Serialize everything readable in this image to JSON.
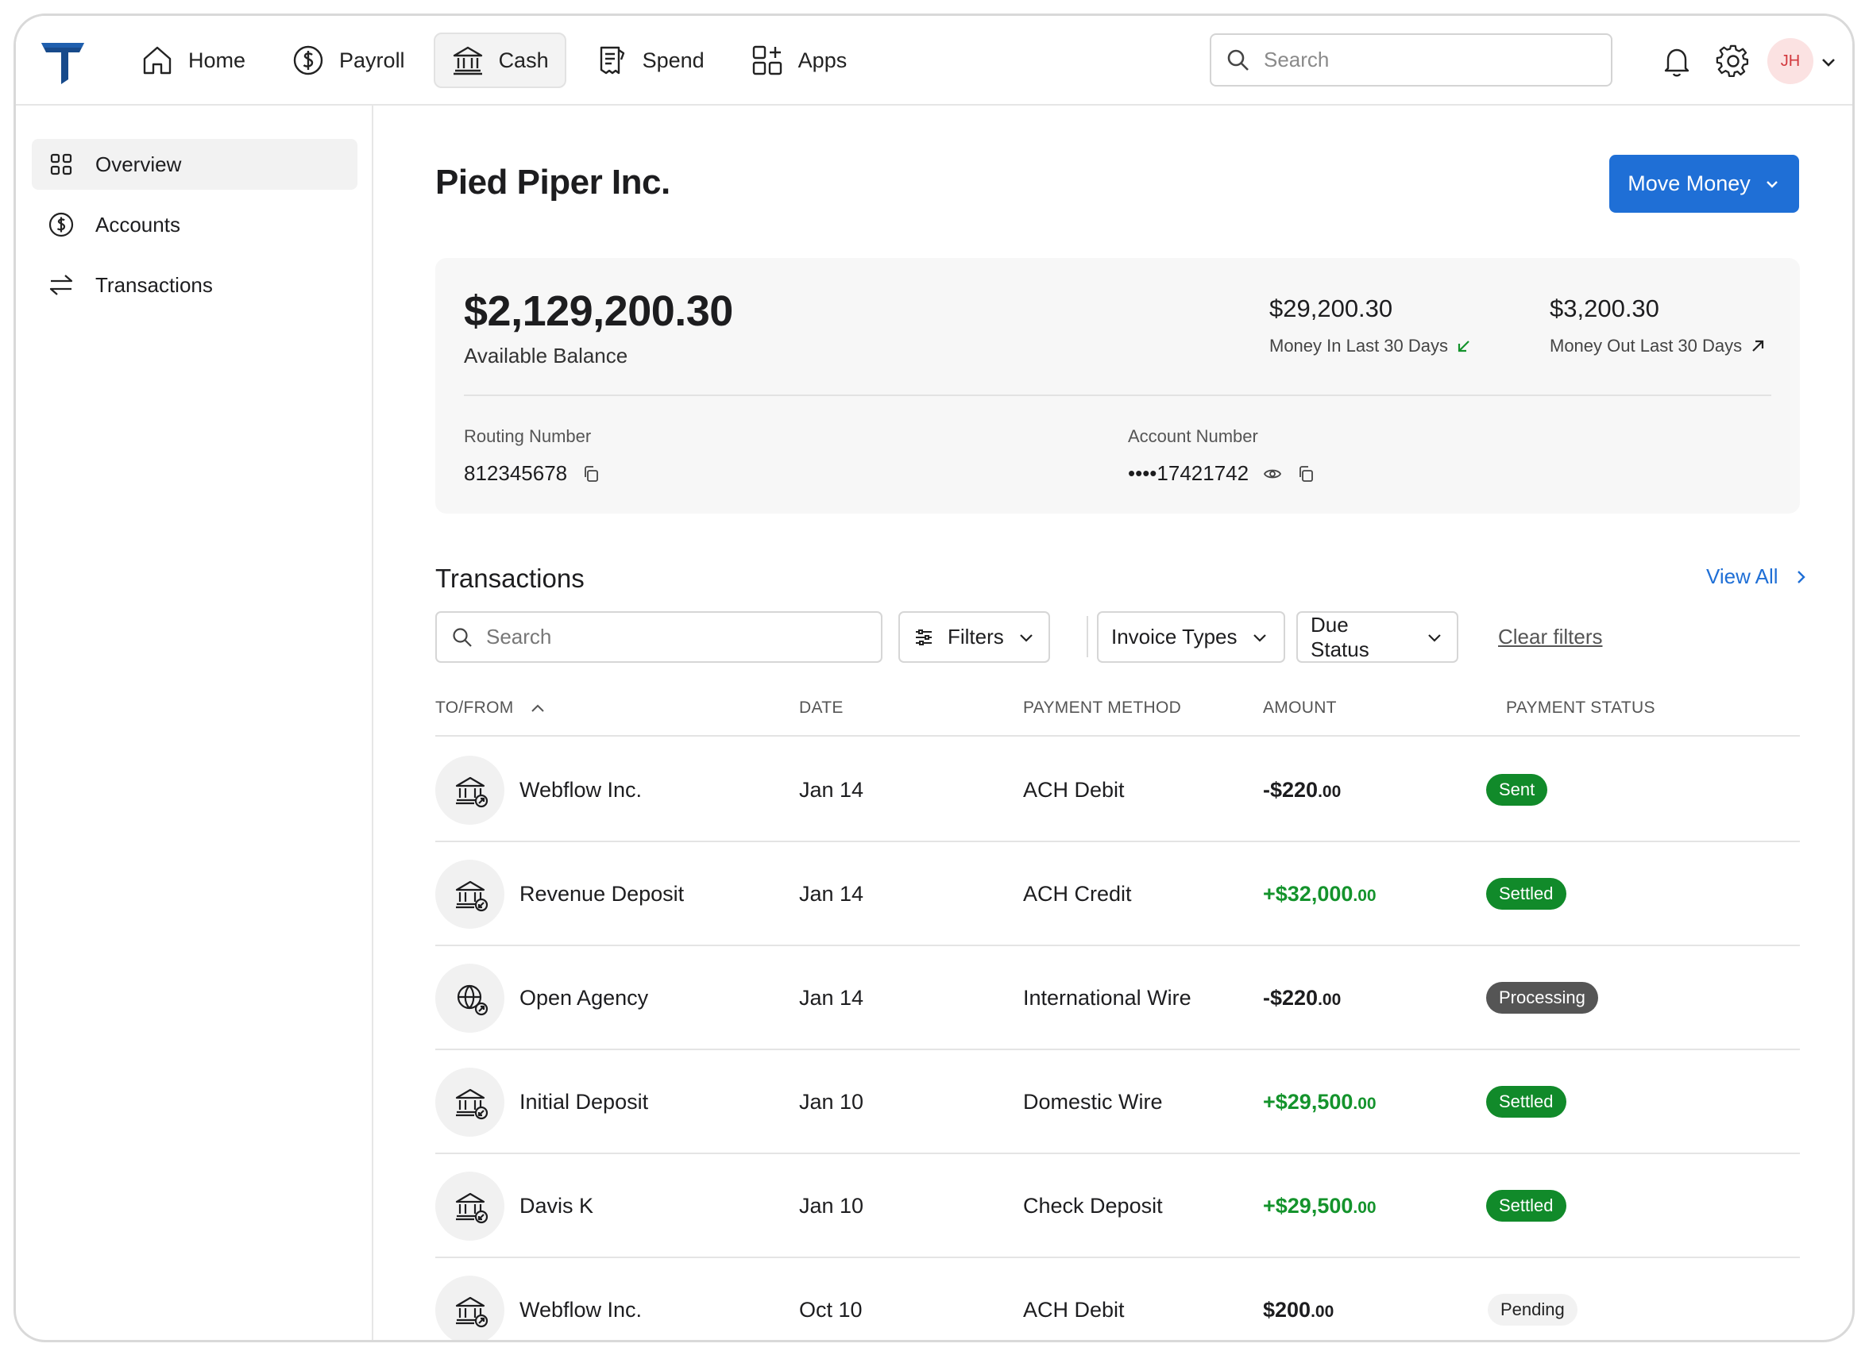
{
  "nav": {
    "items": [
      {
        "label": "Home",
        "icon": "home-icon"
      },
      {
        "label": "Payroll",
        "icon": "dollar-circle-icon"
      },
      {
        "label": "Cash",
        "icon": "bank-icon"
      },
      {
        "label": "Spend",
        "icon": "receipt-icon"
      },
      {
        "label": "Apps",
        "icon": "apps-grid-icon"
      }
    ],
    "active": "Cash",
    "search_placeholder": "Search",
    "avatar_initials": "JH"
  },
  "sidebar": {
    "items": [
      {
        "label": "Overview",
        "icon": "grid-icon"
      },
      {
        "label": "Accounts",
        "icon": "dollar-circle-icon"
      },
      {
        "label": "Transactions",
        "icon": "arrows-icon"
      }
    ],
    "active": "Overview"
  },
  "page": {
    "title": "Pied Piper Inc.",
    "move_money_label": "Move Money"
  },
  "balance": {
    "amount": "$2,129,200.30",
    "label": "Available Balance",
    "money_in": {
      "amount": "$29,200.30",
      "label": "Money In Last 30 Days"
    },
    "money_out": {
      "amount": "$3,200.30",
      "label": "Money Out Last 30 Days"
    },
    "routing": {
      "label": "Routing Number",
      "value": "812345678"
    },
    "account": {
      "label": "Account Number",
      "value": "••••17421742"
    }
  },
  "transactions": {
    "title": "Transactions",
    "view_all": "View All",
    "search_placeholder": "Search",
    "filters_label": "Filters",
    "invoice_types_label": "Invoice Types",
    "due_status_label": "Due Status",
    "clear_filters": "Clear filters",
    "columns": [
      "TO/FROM",
      "DATE",
      "PAYMENT METHOD",
      "AMOUNT",
      "PAYMENT STATUS"
    ],
    "rows": [
      {
        "name": "Webflow Inc.",
        "date": "Jan 14",
        "method": "ACH Debit",
        "amount_main": "-$220",
        "amount_cents": ".00",
        "positive": false,
        "status": "Sent",
        "status_style": "green",
        "icon": "bank-out-icon"
      },
      {
        "name": "Revenue Deposit",
        "date": "Jan 14",
        "method": "ACH Credit",
        "amount_main": "+$32,000",
        "amount_cents": ".00",
        "positive": true,
        "status": "Settled",
        "status_style": "green",
        "icon": "bank-in-icon"
      },
      {
        "name": "Open Agency",
        "date": "Jan 14",
        "method": "International Wire",
        "amount_main": "-$220",
        "amount_cents": ".00",
        "positive": false,
        "status": "Processing",
        "status_style": "gray",
        "icon": "globe-out-icon"
      },
      {
        "name": "Initial Deposit",
        "date": "Jan 10",
        "method": "Domestic Wire",
        "amount_main": "+$29,500",
        "amount_cents": ".00",
        "positive": true,
        "status": "Settled",
        "status_style": "green",
        "icon": "bank-in-icon"
      },
      {
        "name": "Davis K",
        "date": "Jan 10",
        "method": "Check Deposit",
        "amount_main": "+$29,500",
        "amount_cents": ".00",
        "positive": true,
        "status": "Settled",
        "status_style": "green",
        "icon": "bank-in-icon"
      },
      {
        "name": "Webflow Inc.",
        "date": "Oct 10",
        "method": "ACH Debit",
        "amount_main": "$200",
        "amount_cents": ".00",
        "positive": false,
        "status": "Pending",
        "status_style": "light",
        "icon": "bank-out-icon"
      }
    ]
  },
  "colors": {
    "accent": "#1f6fd6",
    "brand": "#174a8b",
    "positive": "#14932c",
    "badge_green": "#118a2a",
    "badge_gray": "#555555"
  }
}
